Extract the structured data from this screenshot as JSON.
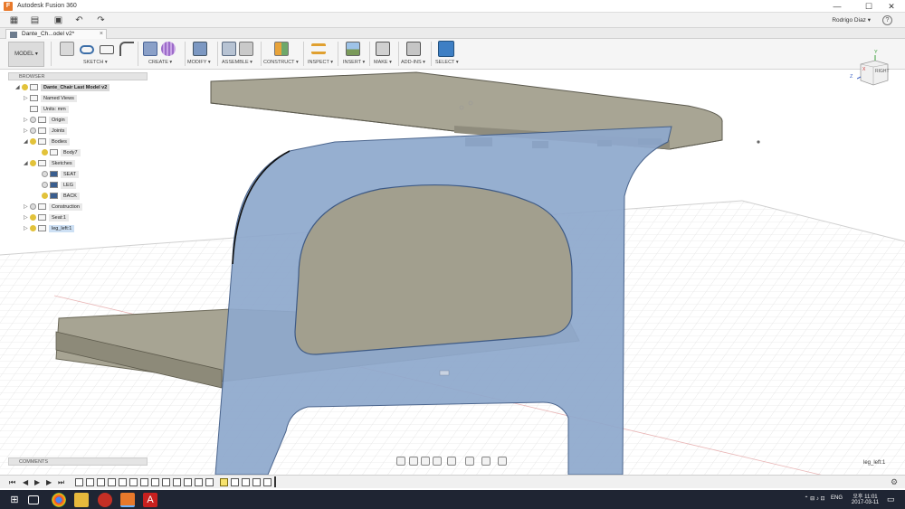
{
  "window": {
    "app_title": "Autodesk Fusion 360",
    "minimize_glyph": "—",
    "maximize_glyph": "☐",
    "close_glyph": "✕"
  },
  "quick_access": {
    "user_name": "Rodrigo Diaz ▾",
    "help_glyph": "?"
  },
  "document_tab": {
    "title": "Dante_Ch...odel v2*",
    "close_glyph": "×"
  },
  "toolbar": {
    "workspace": "MODEL ▾",
    "groups": [
      {
        "label": "SKETCH ▾"
      },
      {
        "label": "CREATE ▾"
      },
      {
        "label": "MODIFY ▾"
      },
      {
        "label": "ASSEMBLE ▾"
      },
      {
        "label": "CONSTRUCT ▾"
      },
      {
        "label": "INSPECT ▾"
      },
      {
        "label": "INSERT ▾"
      },
      {
        "label": "MAKE ▾"
      },
      {
        "label": "ADD-INS ▾"
      },
      {
        "label": "SELECT ▾"
      }
    ]
  },
  "browser": {
    "header": "BROWSER",
    "root": "Dante_Chair Last Model v2",
    "items": [
      {
        "label": "Named Views"
      },
      {
        "label": "Units: mm"
      },
      {
        "label": "Origin"
      },
      {
        "label": "Joints"
      },
      {
        "label": "Bodies"
      },
      {
        "label": "Body7"
      },
      {
        "label": "Sketches"
      },
      {
        "label": "SEAT"
      },
      {
        "label": "LEG"
      },
      {
        "label": "BACK"
      },
      {
        "label": "Construction"
      },
      {
        "label": "Seat:1"
      },
      {
        "label": "leg_left:1"
      }
    ]
  },
  "comments": {
    "header": "COMMENTS"
  },
  "viewcube": {
    "face_label": "RIGHT",
    "axis_x": "X",
    "axis_y": "Y",
    "axis_z": "Z"
  },
  "viewport": {
    "selection_label": "leg_left:1"
  },
  "taskbar": {
    "language": "ENG",
    "time_line1": "오후 11:01",
    "time_line2": "2017-03-11"
  },
  "colors": {
    "leg_fill": "#8fa9cd",
    "seat_fill": "#a3a08f",
    "grid_line": "#e1e1e1",
    "selected_item": "#f7e36d",
    "taskbar": "#1f2533"
  }
}
